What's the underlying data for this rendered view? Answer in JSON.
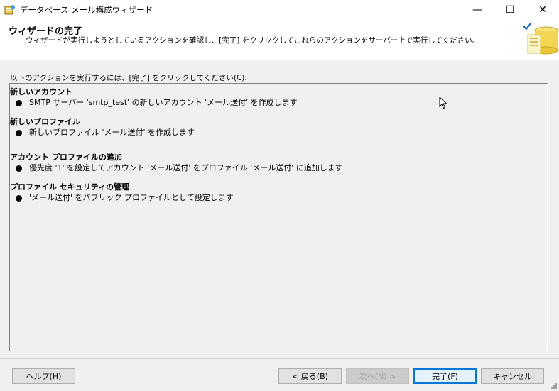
{
  "window": {
    "title": "データベース メール構成ウィザード",
    "minimize": "—",
    "maximize": "☐",
    "close": "✕"
  },
  "header": {
    "title": "ウィザードの完了",
    "subtitle": "ウィザードが実行しようとしているアクションを確認し、[完了] をクリックしてこれらのアクションをサーバー上で実行してください。"
  },
  "instruction": "以下のアクションを実行するには、[完了] をクリックしてください(C):",
  "sections": [
    {
      "title": "新しいアカウント",
      "items": [
        "SMTP サーバー 'smtp_test' の新しいアカウント 'メール送付' を作成します"
      ]
    },
    {
      "title": "新しいプロファイル",
      "items": [
        "新しいプロファイル 'メール送付' を作成します"
      ]
    },
    {
      "title": "アカウント プロファイルの追加",
      "items": [
        "優先度 '1' を設定してアカウント 'メール送付' をプロファイル 'メール送付' に追加します"
      ]
    },
    {
      "title": "プロファイル セキュリティの管理",
      "items": [
        "'メール送付' をパブリック プロファイルとして設定します"
      ]
    }
  ],
  "buttons": {
    "help": "ヘルプ(H)",
    "back": "< 戻る(B)",
    "next": "次へ(N) >",
    "finish": "完了(F)",
    "cancel": "キャンセル"
  }
}
